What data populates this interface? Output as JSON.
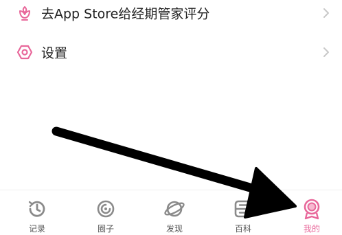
{
  "menu": {
    "rate_app": {
      "label": "去App Store给经期管家评分",
      "icon": "flower-icon"
    },
    "settings": {
      "label": "设置",
      "icon": "gear-icon"
    }
  },
  "tabbar": {
    "items": [
      {
        "label": "记录",
        "icon": "clock-history-icon",
        "active": false
      },
      {
        "label": "圈子",
        "icon": "circle-swirl-icon",
        "active": false
      },
      {
        "label": "发现",
        "icon": "planet-icon",
        "active": false
      },
      {
        "label": "百科",
        "icon": "book-icon",
        "active": false
      },
      {
        "label": "我的",
        "icon": "profile-icon",
        "active": true
      }
    ]
  },
  "colors": {
    "accent": "#e8679a",
    "icon_gray": "#8a8a8a",
    "chevron": "#c8c8c8",
    "annotation_arrow": "#000000"
  },
  "annotation": {
    "type": "arrow",
    "points_to": "tab-mine"
  }
}
